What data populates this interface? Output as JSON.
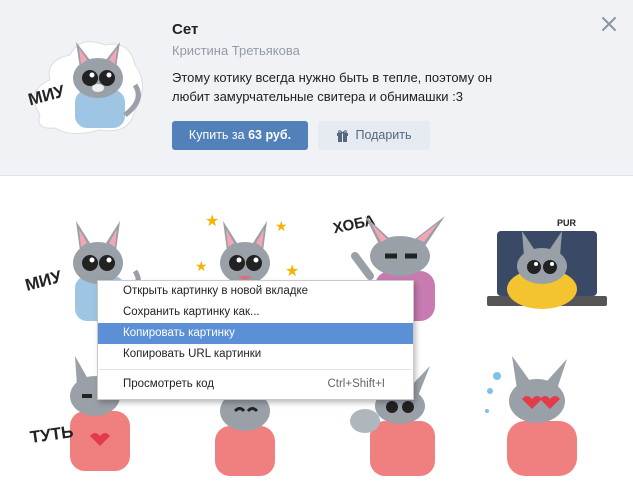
{
  "set": {
    "title": "Сет",
    "author": "Кристина Третьякова",
    "description": "Этому котику всегда нужно быть в тепле, поэтому он любит замурчательные свитера и обнимашки :3",
    "buy_prefix": "Купить за ",
    "buy_price": "63 руб.",
    "gift_label": "Подарить",
    "preview_caption": "МИУ"
  },
  "stickers": [
    {
      "caption": "МИУ",
      "sweater": "#9ec5e3"
    },
    {
      "caption": "",
      "sweater": "#e8b8c8"
    },
    {
      "caption": "ХОБА",
      "sweater": "#c77bb0"
    },
    {
      "caption": "PUR",
      "sweater": "#f4c430"
    },
    {
      "caption": "ТУТЬ",
      "sweater": "#f08080"
    },
    {
      "caption": "",
      "sweater": "#f08080"
    },
    {
      "caption": "",
      "sweater": "#f08080"
    },
    {
      "caption": "",
      "sweater": "#f08080"
    }
  ],
  "context_menu": {
    "items": [
      {
        "label": "Открыть картинку в новой вкладке",
        "shortcut": ""
      },
      {
        "label": "Сохранить картинку как...",
        "shortcut": ""
      },
      {
        "label": "Копировать картинку",
        "shortcut": "",
        "active": true
      },
      {
        "label": "Копировать URL картинки",
        "shortcut": ""
      },
      {
        "label": "Просмотреть код",
        "shortcut": "Ctrl+Shift+I"
      }
    ]
  },
  "colors": {
    "accent": "#5181b8",
    "header_bg": "#f0f2f5",
    "menu_highlight": "#5b8fd6"
  }
}
